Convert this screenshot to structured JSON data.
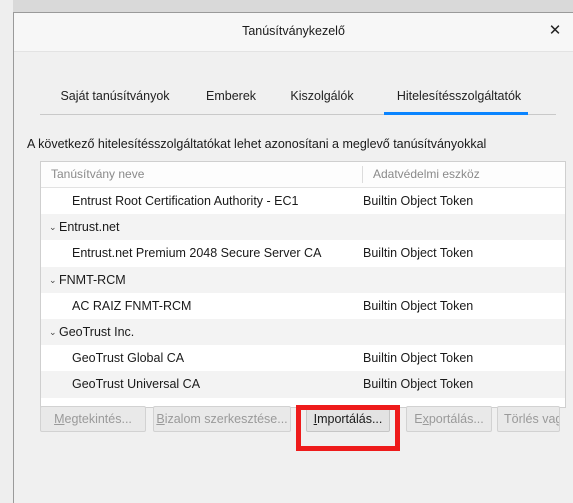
{
  "window": {
    "title": "Tanúsítványkezelő",
    "close_glyph": "✕"
  },
  "tabs": [
    {
      "label": "Saját tanúsítványok",
      "active": false
    },
    {
      "label": "Emberek",
      "active": false
    },
    {
      "label": "Kiszolgálók",
      "active": false
    },
    {
      "label": "Hitelesítésszolgáltatók",
      "active": true
    }
  ],
  "description": "A következő hitelesítésszolgáltatókat lehet azonosítani a meglevő tanúsítványokkal",
  "tree": {
    "columns": [
      "Tanúsítvány neve",
      "Adatvédelmi eszköz"
    ],
    "rows": [
      {
        "kind": "cert",
        "name": "Entrust Root Certification Authority - EC1",
        "device": "Builtin Object Token"
      },
      {
        "kind": "group",
        "name": "Entrust.net",
        "chevron": "⌄"
      },
      {
        "kind": "cert",
        "name": "Entrust.net Premium 2048 Secure Server CA",
        "device": "Builtin Object Token"
      },
      {
        "kind": "group",
        "name": "FNMT-RCM",
        "chevron": "⌄"
      },
      {
        "kind": "cert",
        "name": "AC RAIZ FNMT-RCM",
        "device": "Builtin Object Token"
      },
      {
        "kind": "group",
        "name": "GeoTrust Inc.",
        "chevron": "⌄"
      },
      {
        "kind": "cert",
        "name": "GeoTrust Global CA",
        "device": "Builtin Object Token"
      },
      {
        "kind": "cert",
        "name": "GeoTrust Universal CA",
        "device": "Builtin Object Token"
      }
    ]
  },
  "buttons": {
    "view": {
      "label": "Megtekintés...",
      "accesskey": "M",
      "enabled": false
    },
    "edit_trust": {
      "label": "Bizalom szerkesztése...",
      "accesskey": "B",
      "enabled": false
    },
    "import": {
      "label": "Importálás...",
      "accesskey": "I",
      "enabled": true
    },
    "export": {
      "label": "Exportálás...",
      "accesskey": "x",
      "enabled": false
    },
    "delete": {
      "label": "Törlés vagy",
      "accesskey": "y",
      "enabled": false
    }
  },
  "highlight_color": "#ee1b1b",
  "accent_color": "#0a84ff"
}
